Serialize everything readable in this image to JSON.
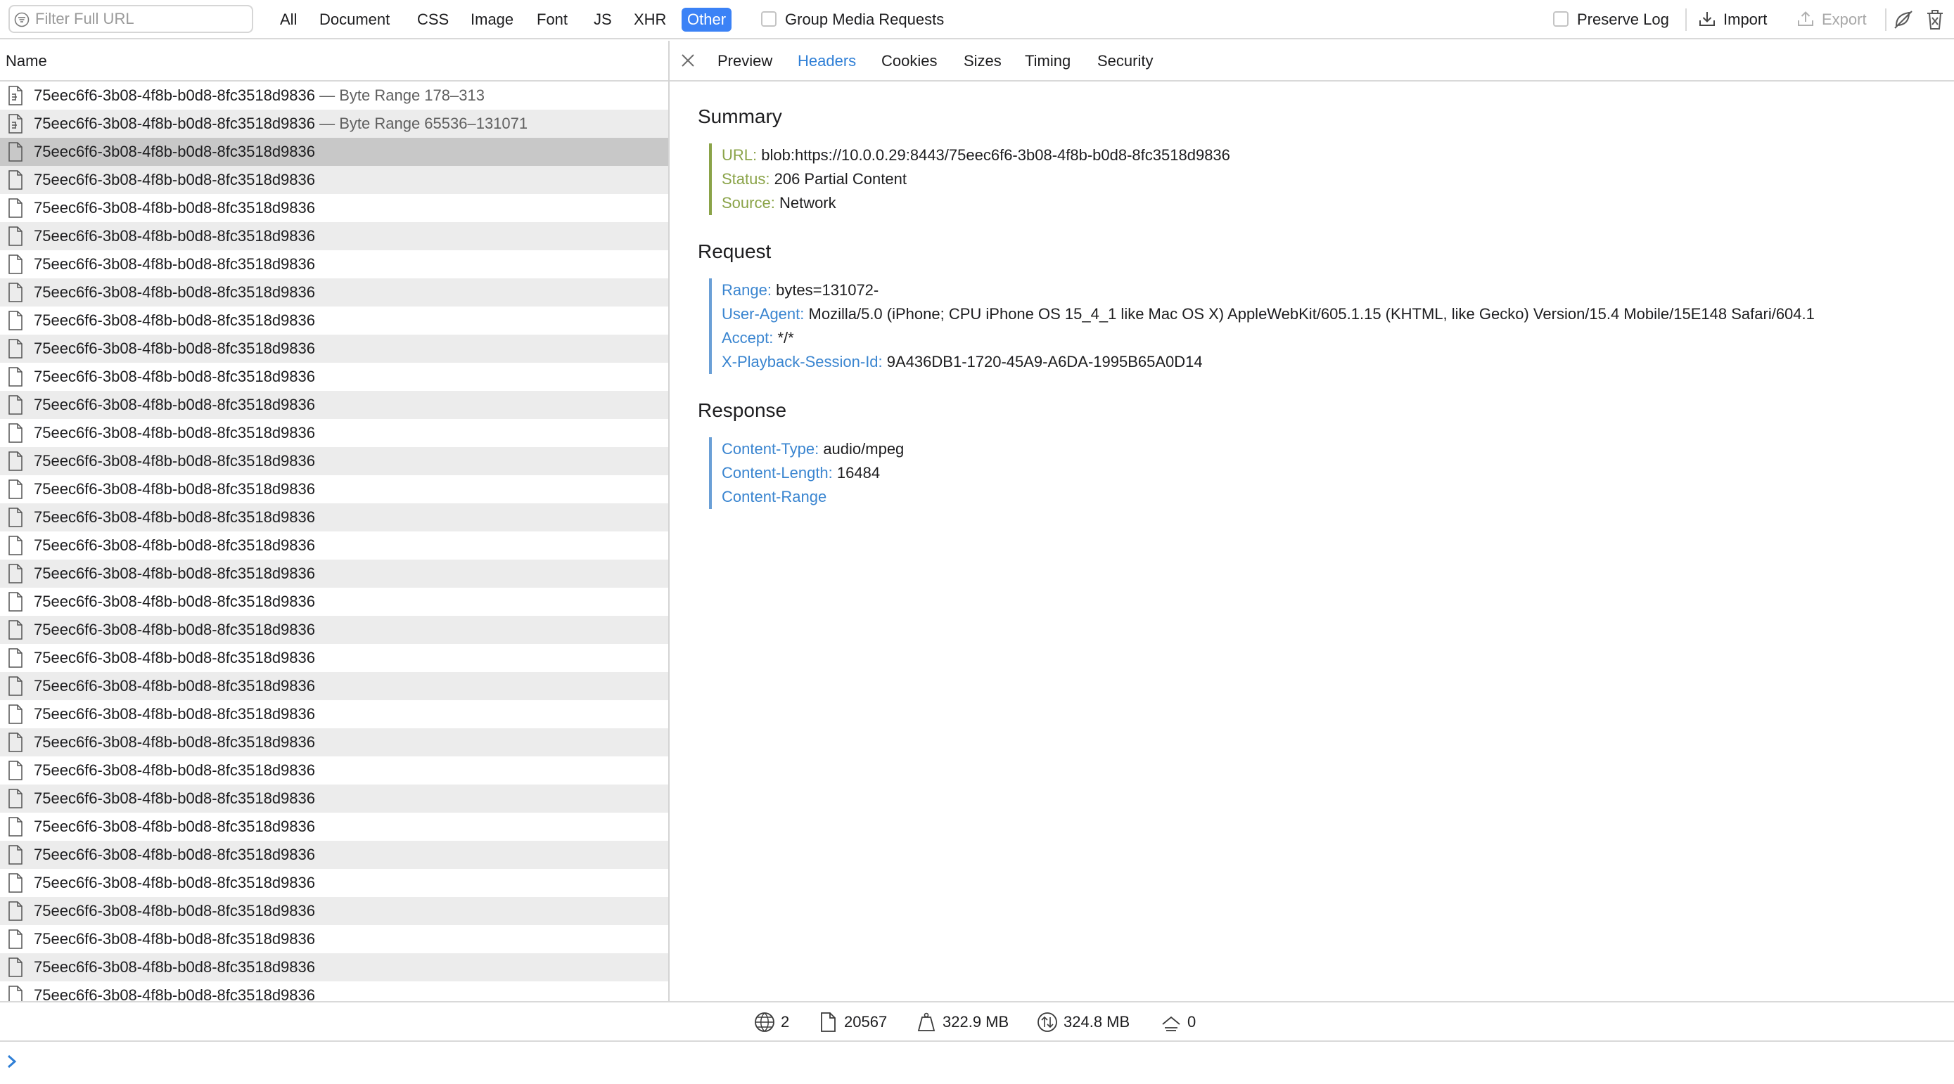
{
  "toolbar": {
    "filter_placeholder": "Filter Full URL",
    "type_tabs": [
      "All",
      "Document",
      "CSS",
      "Image",
      "Font",
      "JS",
      "XHR",
      "Other"
    ],
    "selected_type": "Other",
    "group_media_label": "Group Media Requests",
    "group_media_checked": false,
    "preserve_log_label": "Preserve Log",
    "preserve_log_checked": false,
    "import_label": "Import",
    "export_label": "Export",
    "accent_color": "#3b82f6"
  },
  "list": {
    "header": "Name",
    "resource_name": "75eec6f6-3b08-4f8b-b0d8-8fc3518d9836",
    "rows": [
      {
        "name": "75eec6f6-3b08-4f8b-b0d8-8fc3518d9836",
        "suffix": " — Byte Range 178–313",
        "icon": "media-file-icon"
      },
      {
        "name": "75eec6f6-3b08-4f8b-b0d8-8fc3518d9836",
        "suffix": " — Byte Range 65536–131071",
        "icon": "media-file-icon"
      },
      {
        "name": "75eec6f6-3b08-4f8b-b0d8-8fc3518d9836",
        "selected": true
      },
      {
        "name": "75eec6f6-3b08-4f8b-b0d8-8fc3518d9836"
      },
      {
        "name": "75eec6f6-3b08-4f8b-b0d8-8fc3518d9836"
      },
      {
        "name": "75eec6f6-3b08-4f8b-b0d8-8fc3518d9836"
      },
      {
        "name": "75eec6f6-3b08-4f8b-b0d8-8fc3518d9836"
      },
      {
        "name": "75eec6f6-3b08-4f8b-b0d8-8fc3518d9836"
      },
      {
        "name": "75eec6f6-3b08-4f8b-b0d8-8fc3518d9836"
      },
      {
        "name": "75eec6f6-3b08-4f8b-b0d8-8fc3518d9836"
      },
      {
        "name": "75eec6f6-3b08-4f8b-b0d8-8fc3518d9836"
      },
      {
        "name": "75eec6f6-3b08-4f8b-b0d8-8fc3518d9836"
      },
      {
        "name": "75eec6f6-3b08-4f8b-b0d8-8fc3518d9836"
      },
      {
        "name": "75eec6f6-3b08-4f8b-b0d8-8fc3518d9836"
      },
      {
        "name": "75eec6f6-3b08-4f8b-b0d8-8fc3518d9836"
      },
      {
        "name": "75eec6f6-3b08-4f8b-b0d8-8fc3518d9836"
      },
      {
        "name": "75eec6f6-3b08-4f8b-b0d8-8fc3518d9836"
      },
      {
        "name": "75eec6f6-3b08-4f8b-b0d8-8fc3518d9836"
      },
      {
        "name": "75eec6f6-3b08-4f8b-b0d8-8fc3518d9836"
      },
      {
        "name": "75eec6f6-3b08-4f8b-b0d8-8fc3518d9836"
      },
      {
        "name": "75eec6f6-3b08-4f8b-b0d8-8fc3518d9836"
      },
      {
        "name": "75eec6f6-3b08-4f8b-b0d8-8fc3518d9836"
      },
      {
        "name": "75eec6f6-3b08-4f8b-b0d8-8fc3518d9836"
      },
      {
        "name": "75eec6f6-3b08-4f8b-b0d8-8fc3518d9836"
      },
      {
        "name": "75eec6f6-3b08-4f8b-b0d8-8fc3518d9836"
      },
      {
        "name": "75eec6f6-3b08-4f8b-b0d8-8fc3518d9836"
      },
      {
        "name": "75eec6f6-3b08-4f8b-b0d8-8fc3518d9836"
      },
      {
        "name": "75eec6f6-3b08-4f8b-b0d8-8fc3518d9836"
      },
      {
        "name": "75eec6f6-3b08-4f8b-b0d8-8fc3518d9836"
      },
      {
        "name": "75eec6f6-3b08-4f8b-b0d8-8fc3518d9836"
      },
      {
        "name": "75eec6f6-3b08-4f8b-b0d8-8fc3518d9836"
      },
      {
        "name": "75eec6f6-3b08-4f8b-b0d8-8fc3518d9836"
      },
      {
        "name": "75eec6f6-3b08-4f8b-b0d8-8fc3518d9836"
      },
      {
        "name": "75eec6f6-3b08-4f8b-b0d8-8fc3518d9836"
      }
    ]
  },
  "detail": {
    "tabs": [
      "Preview",
      "Headers",
      "Cookies",
      "Sizes",
      "Timing",
      "Security"
    ],
    "active_tab": "Headers",
    "summary": {
      "title": "Summary",
      "items": [
        {
          "key": "URL:",
          "value": "blob:https://10.0.0.29:8443/75eec6f6-3b08-4f8b-b0d8-8fc3518d9836"
        },
        {
          "key": "Status:",
          "value": "206 Partial Content"
        },
        {
          "key": "Source:",
          "value": "Network"
        }
      ]
    },
    "request": {
      "title": "Request",
      "items": [
        {
          "key": "Range:",
          "value": "bytes=131072-"
        },
        {
          "key": "User-Agent:",
          "value": "Mozilla/5.0 (iPhone; CPU iPhone OS 15_4_1 like Mac OS X) AppleWebKit/605.1.15 (KHTML, like Gecko) Version/15.4 Mobile/15E148 Safari/604.1"
        },
        {
          "key": "Accept:",
          "value": "*/*"
        },
        {
          "key": "X-Playback-Session-Id:",
          "value": "9A436DB1-1720-45A9-A6DA-1995B65A0D14"
        }
      ]
    },
    "response": {
      "title": "Response",
      "items": [
        {
          "key": "Content-Type:",
          "value": "audio/mpeg"
        },
        {
          "key": "Content-Length:",
          "value": "16484"
        },
        {
          "key": "Content-Range",
          "value": ""
        }
      ]
    },
    "summary_color": "#8aa348",
    "header_key_color": "#3a85d0"
  },
  "status_bar": {
    "domains": "2",
    "resources": "20567",
    "size": "322.9 MB",
    "transferred": "324.8 MB",
    "errors": "0"
  }
}
